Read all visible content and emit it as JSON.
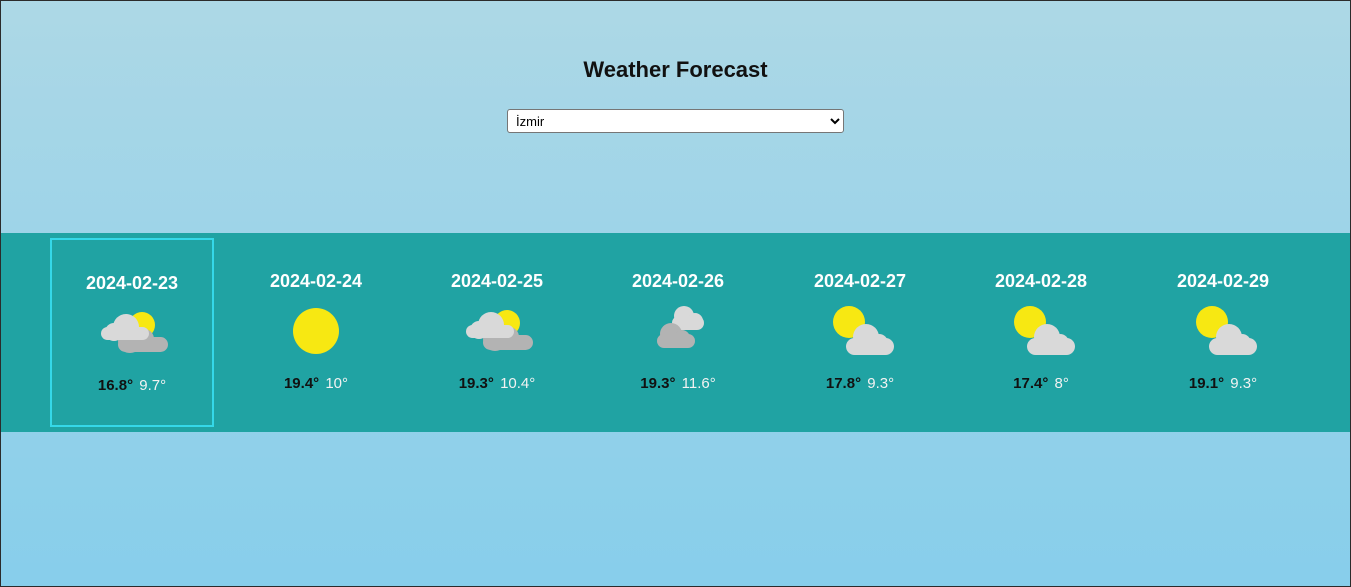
{
  "header": {
    "title": "Weather Forecast"
  },
  "city_select": {
    "selected": "İzmir",
    "options": [
      "İzmir"
    ]
  },
  "forecast": {
    "selected_index": 0,
    "days": [
      {
        "date": "2024-02-23",
        "max": "16.8°",
        "min": "9.7°",
        "icon": "partly-cloudy-sun-behind-icon"
      },
      {
        "date": "2024-02-24",
        "max": "19.4°",
        "min": "10°",
        "icon": "sunny-icon"
      },
      {
        "date": "2024-02-25",
        "max": "19.3°",
        "min": "10.4°",
        "icon": "partly-cloudy-sun-behind-icon"
      },
      {
        "date": "2024-02-26",
        "max": "19.3°",
        "min": "11.6°",
        "icon": "cloudy-icon"
      },
      {
        "date": "2024-02-27",
        "max": "17.8°",
        "min": "9.3°",
        "icon": "sun-cloud-icon"
      },
      {
        "date": "2024-02-28",
        "max": "17.4°",
        "min": "8°",
        "icon": "sun-cloud-icon"
      },
      {
        "date": "2024-02-29",
        "max": "19.1°",
        "min": "9.3°",
        "icon": "sun-cloud-icon"
      }
    ]
  },
  "colors": {
    "strip": "#20a3a3",
    "selected_border": "#35d8e8",
    "sun": "#f7e812",
    "cloud_light": "#d9d9d9",
    "cloud_dark": "#b3b3b3"
  }
}
